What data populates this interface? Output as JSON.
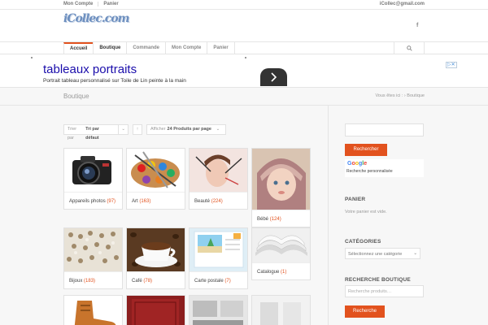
{
  "topbar": {
    "links": [
      "Mon Compte",
      "Panier"
    ],
    "email": "iCollec@gmail.com"
  },
  "header": {
    "logo_text": "iCollec.com",
    "social_icon": "f"
  },
  "nav": {
    "items": [
      "Accueil",
      "Boutique",
      "Commande",
      "Mon Compte",
      "Panier"
    ],
    "active": "Accueil"
  },
  "ad": {
    "title": "tableaux portraits",
    "description": "Portrait tableau personnalisé sur Toile de Lin peinte à la main",
    "ad_choice": "▷✕"
  },
  "page": {
    "title": "Boutique",
    "breadcrumb_prefix": "Vous êtes ici :",
    "breadcrumb_current": "Boutique"
  },
  "sort": {
    "label": "Trier par",
    "value": "Tri par défaut",
    "show_label": "Afficher",
    "show_value": "24 Produits par page"
  },
  "categories": [
    {
      "name": "Appareils photos",
      "count": "(97)"
    },
    {
      "name": "Art",
      "count": "(163)"
    },
    {
      "name": "Beauté",
      "count": "(224)"
    },
    {
      "name": "Bébé",
      "count": "(124)"
    },
    {
      "name": "Bijoux",
      "count": "(183)"
    },
    {
      "name": "Café",
      "count": "(78)"
    },
    {
      "name": "Carte postale",
      "count": "(7)"
    },
    {
      "name": "Catalogue",
      "count": "(1)"
    }
  ],
  "sidebar": {
    "search_button": "Rechercher",
    "google_brand": "Google",
    "google_sub": "Recherche personnalisée",
    "cart_heading": "PANIER",
    "cart_empty": "Votre panier est vide.",
    "categories_heading": "CATÉGORIES",
    "categories_select": "Sélectionnez une catégorie",
    "shop_search_heading": "RECHERCHE BOUTIQUE",
    "shop_search_placeholder": "Recherche produits…",
    "shop_search_button": "Recherche"
  },
  "colors": {
    "accent": "#e2521e",
    "ad_link": "#1a0dab"
  }
}
